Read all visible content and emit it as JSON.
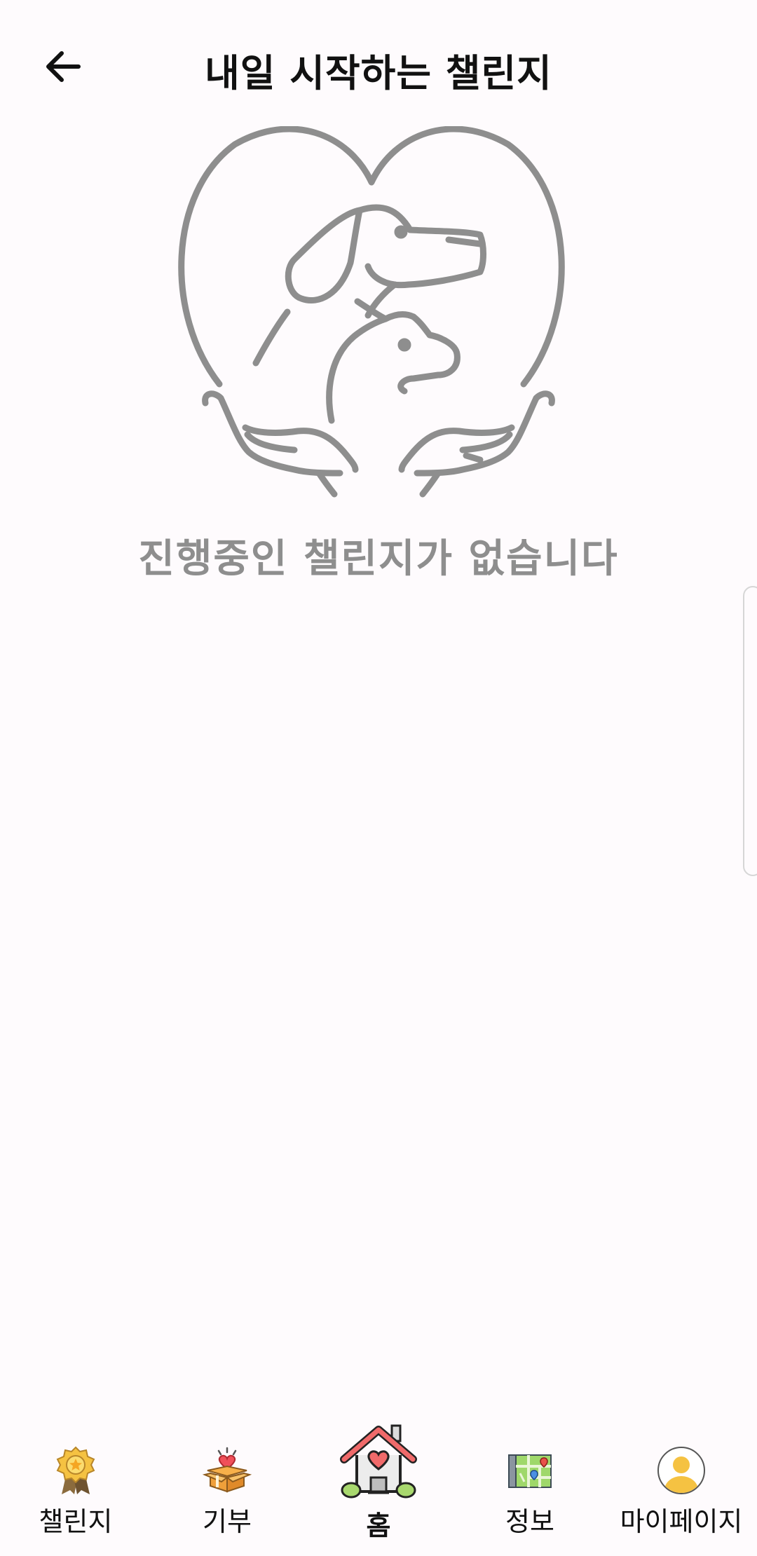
{
  "header": {
    "title": "내일 시작하는 챌린지"
  },
  "empty_state": {
    "message": "진행중인 챌린지가 없습니다"
  },
  "bottom_nav": {
    "items": [
      {
        "label": "챌린지",
        "icon": "medal-icon"
      },
      {
        "label": "기부",
        "icon": "gift-box-icon"
      },
      {
        "label": "홈",
        "icon": "home-icon"
      },
      {
        "label": "정보",
        "icon": "map-icon"
      },
      {
        "label": "마이페이지",
        "icon": "profile-icon"
      }
    ]
  },
  "colors": {
    "background": "#fefbfd",
    "illustration_stroke": "#8e8e8e",
    "empty_text": "#8e8e8e",
    "accent_yellow": "#f5c242",
    "home_roof": "#f06a6a"
  }
}
